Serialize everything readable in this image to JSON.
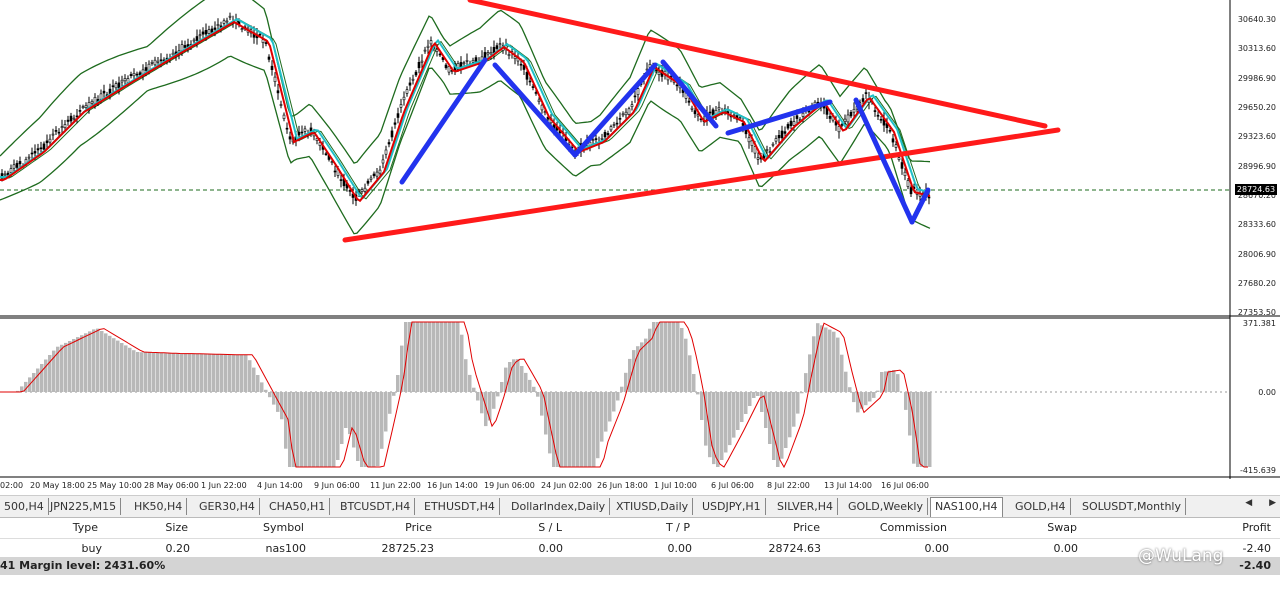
{
  "chart": {
    "symbol": "NAS100",
    "timeframe": "H4",
    "current_price": "28724.63",
    "price_axis": [
      "30640.30",
      "30313.60",
      "29986.90",
      "29650.20",
      "29323.60",
      "28996.90",
      "28670.20",
      "28333.60",
      "28006.90",
      "27680.20",
      "27353.50"
    ],
    "oscillator_axis": [
      "371.381",
      "0.00",
      "-415.639"
    ],
    "time_axis": [
      "02:00",
      "20 May 18:00",
      "25 May 10:00",
      "28 May 06:00",
      "1 Jun 22:00",
      "4 Jun 14:00",
      "9 Jun 06:00",
      "11 Jun 22:00",
      "16 Jun 14:00",
      "19 Jun 06:00",
      "24 Jun 02:00",
      "26 Jun 18:00",
      "1 Jul 10:00",
      "6 Jul 06:00",
      "8 Jul 22:00",
      "13 Jul 14:00",
      "16 Jul 06:00"
    ],
    "colors": {
      "bollinger": "#1e6b1e",
      "ma_fast": "#e00000",
      "ma_slow": "#20c0c8",
      "candles": "#000000",
      "triangle": "#ff1a1a",
      "zigzag": "#2233ee",
      "histogram": "#b8b8b8",
      "signal": "#e00000"
    }
  },
  "chart_data": {
    "type": "candlestick",
    "title": "",
    "price_ticks": [
      30640.3,
      30313.6,
      29986.9,
      29650.2,
      29323.6,
      28996.9,
      28670.2,
      28333.6,
      28006.9,
      27680.2,
      27353.5
    ],
    "current_price": 28724.63,
    "oscillator_range": [
      -415.639,
      371.381
    ]
  },
  "tabs": [
    {
      "label": "500,H4"
    },
    {
      "label": "JPN225,M15"
    },
    {
      "label": "HK50,H4"
    },
    {
      "label": "GER30,H4"
    },
    {
      "label": "CHA50,H1"
    },
    {
      "label": "BTCUSDT,H4"
    },
    {
      "label": "ETHUSDT,H4"
    },
    {
      "label": "DollarIndex,Daily"
    },
    {
      "label": "XTIUSD,Daily"
    },
    {
      "label": "USDJPY,H1"
    },
    {
      "label": "SILVER,H4"
    },
    {
      "label": "GOLD,Weekly"
    },
    {
      "label": "NAS100,H4"
    },
    {
      "label": "GOLD,H4"
    },
    {
      "label": "SOLUSDT,Monthly"
    }
  ],
  "tab_arrows": {
    "left": "◀",
    "right": "▶"
  },
  "trade_table": {
    "headers": [
      "Type",
      "Size",
      "Symbol",
      "Price",
      "S / L",
      "T / P",
      "Price",
      "Commission",
      "Swap",
      "Profit"
    ],
    "row": [
      "buy",
      "0.20",
      "nas100",
      "28725.23",
      "0.00",
      "0.00",
      "28724.63",
      "0.00",
      "0.00",
      "-2.40"
    ]
  },
  "status": {
    "text": "41  Margin level: 2431.60%",
    "trailing_value": "-2.40"
  },
  "watermark": "@WuLang"
}
